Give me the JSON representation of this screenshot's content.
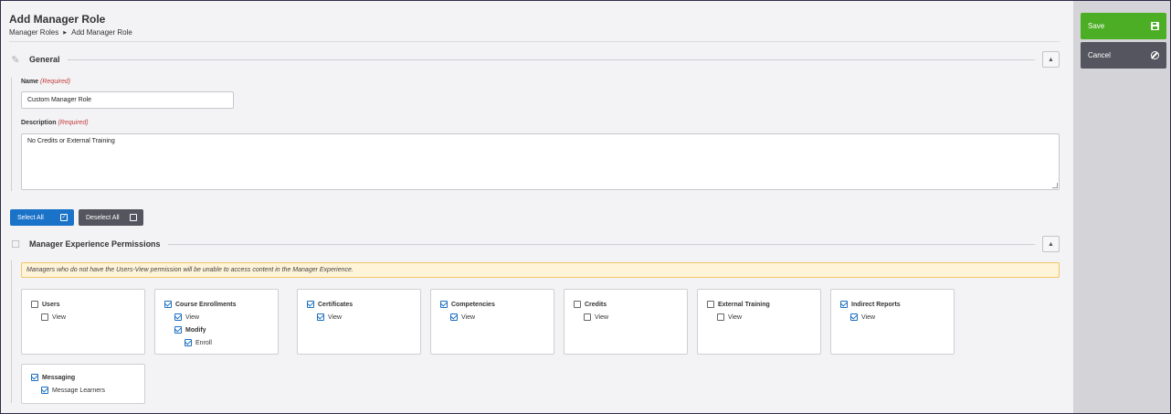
{
  "header": {
    "title": "Add Manager Role",
    "breadcrumb": [
      "Manager Roles",
      "Add Manager Role"
    ]
  },
  "general": {
    "title": "General",
    "name_label": "Name",
    "name_required": "(Required)",
    "name_value": "Custom Manager Role",
    "description_label": "Description",
    "description_required": "(Required)",
    "description_value": "No Credits or External Training"
  },
  "actions": {
    "select_all": "Select All",
    "deselect_all": "Deselect All"
  },
  "permissions": {
    "title": "Manager Experience Permissions",
    "warning": "Managers who do not have the Users-View permission will be unable to access content in the Manager Experience.",
    "groups": [
      {
        "label": "Users",
        "checked": false,
        "children": [
          {
            "label": "View",
            "checked": false
          }
        ]
      },
      {
        "label": "Course Enrollments",
        "checked": true,
        "children": [
          {
            "label": "View",
            "checked": true
          },
          {
            "label": "Modify",
            "checked": true,
            "children": [
              {
                "label": "Enroll",
                "checked": true
              }
            ]
          }
        ]
      },
      {
        "label": "Certificates",
        "checked": true,
        "children": [
          {
            "label": "View",
            "checked": true
          }
        ]
      },
      {
        "label": "Competencies",
        "checked": true,
        "children": [
          {
            "label": "View",
            "checked": true
          }
        ]
      },
      {
        "label": "Credits",
        "checked": false,
        "children": [
          {
            "label": "View",
            "checked": false
          }
        ]
      },
      {
        "label": "External Training",
        "checked": false,
        "children": [
          {
            "label": "View",
            "checked": false
          }
        ]
      },
      {
        "label": "Indirect Reports",
        "checked": true,
        "children": [
          {
            "label": "View",
            "checked": true
          }
        ]
      },
      {
        "label": "Messaging",
        "checked": true,
        "children": [
          {
            "label": "Message Learners",
            "checked": true
          }
        ]
      }
    ]
  },
  "sidebar": {
    "save": "Save",
    "cancel": "Cancel"
  },
  "colors": {
    "primary": "#1a72c9",
    "save": "#4cae24",
    "dark_button": "#55555f",
    "required": "#c23a3a",
    "warning_bg": "#fff4d8"
  }
}
